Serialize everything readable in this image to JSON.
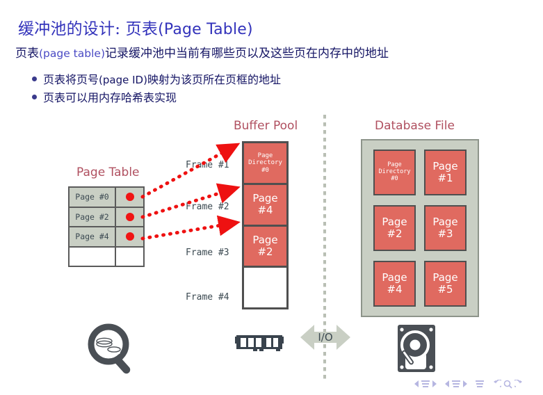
{
  "slide": {
    "title_cjk": "缓冲池的设计: 页表",
    "title_latin": "(Page Table)",
    "lead_cjk_prefix": "页表",
    "lead_latin": "(page table)",
    "lead_cjk_suffix": "记录缓冲池中当前有哪些页以及这些页在内存中的地址",
    "bullets": [
      {
        "cjk_prefix": "页表将页号",
        "latin": "(page ID)",
        "cjk_suffix": "映射为该页所在页框的地址"
      },
      {
        "cjk_prefix": "页表可以用内存哈希表实现",
        "latin": "",
        "cjk_suffix": ""
      }
    ]
  },
  "figure": {
    "headings": {
      "page_table": "Page Table",
      "buffer_pool": "Buffer Pool",
      "database_file": "Database File"
    },
    "page_table_rows": [
      {
        "key": "Page  #0",
        "has_marker": true
      },
      {
        "key": "Page  #2",
        "has_marker": true
      },
      {
        "key": "Page  #4",
        "has_marker": true
      },
      {
        "key": "",
        "has_marker": false
      }
    ],
    "frame_labels": [
      "Frame #1",
      "Frame #2",
      "Frame #3",
      "Frame #4"
    ],
    "buffer_pool_slots": [
      {
        "line1": "Page",
        "line2": "Directory",
        "line3": "#0",
        "kind": "dir"
      },
      {
        "line1": "Page",
        "line2": "#4",
        "line3": "",
        "kind": "page"
      },
      {
        "line1": "Page",
        "line2": "#2",
        "line3": "",
        "kind": "page"
      },
      {
        "line1": "",
        "line2": "",
        "line3": "",
        "kind": "blank"
      }
    ],
    "io_label": "I/O",
    "database_file_cells": [
      {
        "line1": "Page",
        "line2": "Directory",
        "line3": "#0",
        "kind": "dir"
      },
      {
        "line1": "Page",
        "line2": "#1",
        "line3": "",
        "kind": "page"
      },
      {
        "line1": "Page",
        "line2": "#2",
        "line3": "",
        "kind": "page"
      },
      {
        "line1": "Page",
        "line2": "#3",
        "line3": "",
        "kind": "page"
      },
      {
        "line1": "Page",
        "line2": "#4",
        "line3": "",
        "kind": "page"
      },
      {
        "line1": "Page",
        "line2": "#5",
        "line3": "",
        "kind": "page"
      }
    ],
    "icons": {
      "lookup": "magnifier-database-icon",
      "memory": "ram-stick-icon",
      "storage": "hard-disk-icon"
    }
  },
  "colors": {
    "title": "#3333bb",
    "body": "#141464",
    "accent_heading": "#b05060",
    "page_fill": "#e06a60",
    "table_fill": "#c9cfc4",
    "marker": "#f01414",
    "arrow": "#ee1111",
    "divider": "#b9bfb4",
    "icon": "#4a4f55"
  },
  "navigation": {
    "items": [
      "prev-slide",
      "slides-bar",
      "next-slide",
      "prev-frame",
      "frames-bar",
      "next-frame",
      "sections-bar",
      "back",
      "search",
      "forward"
    ]
  }
}
